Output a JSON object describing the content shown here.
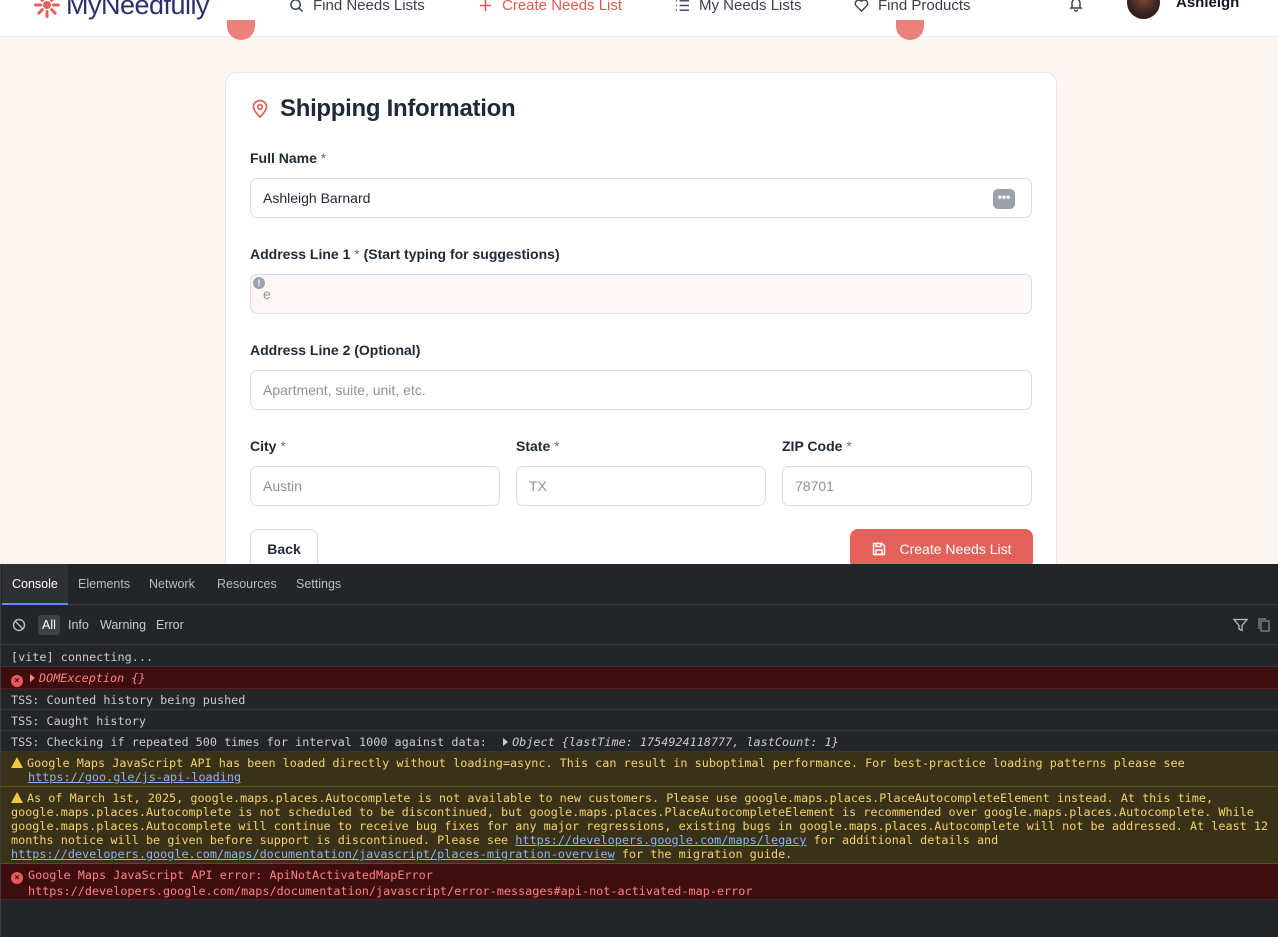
{
  "app": {
    "brand": "MyNeedfully",
    "nav": [
      {
        "label": "Find Needs Lists",
        "icon": "search-icon"
      },
      {
        "label": "Create Needs List",
        "icon": "plus-icon"
      },
      {
        "label": "My Needs Lists",
        "icon": "list-icon"
      },
      {
        "label": "Find Products",
        "icon": "heart-icon"
      }
    ],
    "user_name": "Ashleigh"
  },
  "form": {
    "title": "Shipping Information",
    "full_name_label": "Full Name",
    "full_name_value": "Ashleigh Barnard",
    "address1_label": "Address Line 1",
    "address1_hint": "(Start typing for suggestions)",
    "address1_value": "e",
    "address2_label": "Address Line 2 (Optional)",
    "address2_placeholder": "Apartment, suite, unit, etc.",
    "city_label": "City",
    "city_placeholder": "Austin",
    "state_label": "State",
    "state_placeholder": "TX",
    "zip_label": "ZIP Code",
    "zip_placeholder": "78701",
    "required_mark": "*",
    "back_label": "Back",
    "create_label": "Create Needs List"
  },
  "devtools": {
    "tabs": [
      "Console",
      "Elements",
      "Network",
      "Resources",
      "Settings"
    ],
    "filters": [
      "All",
      "Info",
      "Warning",
      "Error"
    ],
    "logs": {
      "l1": "[vite] connecting...",
      "l2": "DOMException {}",
      "l3": "TSS: Counted history being pushed",
      "l4": "TSS: Caught history",
      "l5_text": "TSS: Checking if repeated 500 times for interval 1000 against data:",
      "l5_obj": "Object {lastTime: 1754924118777, lastCount: 1}",
      "w1_text": "Google Maps JavaScript API has been loaded directly without loading=async. This can result in suboptimal performance. For best-practice loading patterns please see",
      "w1_link": "https://goo.gle/js-api-loading",
      "w2_text": "As of March 1st, 2025, google.maps.places.Autocomplete is not available to new customers. Please use google.maps.places.PlaceAutocompleteElement instead. At this time, google.maps.places.Autocomplete is not scheduled to be discontinued, but google.maps.places.PlaceAutocompleteElement is recommended over google.maps.places.Autocomplete. While google.maps.places.Autocomplete will continue to receive bug fixes for any major regressions, existing bugs in google.maps.places.Autocomplete will not be addressed. At least 12 months notice will be given before support is discontinued. Please see",
      "w2_link1": "https://developers.google.com/maps/legacy",
      "w2_mid": "for additional details and",
      "w2_link2": "https://developers.google.com/maps/documentation/javascript/places-migration-overview",
      "w2_end": "for the migration guide.",
      "e2_text": "Google Maps JavaScript API error: ApiNotActivatedMapError",
      "e2_url": "https://developers.google.com/maps/documentation/javascript/error-messages#api-not-activated-map-error"
    }
  },
  "colors": {
    "accent": "#e4615a",
    "brand_text": "#2b2f6b",
    "devtools_bg": "#242528",
    "error_bg": "#3d0d0f",
    "warning_bg": "#3a3218"
  }
}
